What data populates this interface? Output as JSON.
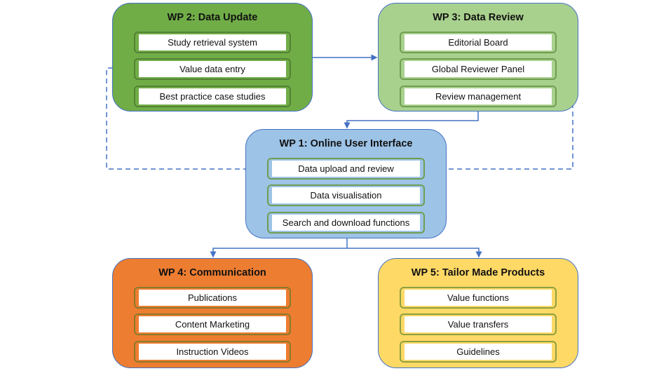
{
  "diagram": {
    "work_packages": [
      {
        "id": "wp2",
        "title": "WP 2: Data Update",
        "color": "#70ad47",
        "items": [
          "Study retrieval system",
          "Value data entry",
          "Best practice case studies"
        ]
      },
      {
        "id": "wp3",
        "title": "WP 3: Data Review",
        "color": "#a9d18e",
        "items": [
          "Editorial Board",
          "Global Reviewer Panel",
          "Review management"
        ]
      },
      {
        "id": "wp1",
        "title": "WP 1: Online User Interface",
        "color": "#9dc3e6",
        "items": [
          "Data upload and review",
          "Data visualisation",
          "Search and download functions"
        ]
      },
      {
        "id": "wp4",
        "title": "WP 4: Communication",
        "color": "#ed7d31",
        "items": [
          "Publications",
          "Content Marketing",
          "Instruction Videos"
        ]
      },
      {
        "id": "wp5",
        "title": "WP 5: Tailor Made Products",
        "color": "#ffd966",
        "items": [
          "Value functions",
          "Value transfers",
          "Guidelines"
        ]
      }
    ],
    "connections": [
      {
        "from": "WP 2: Data Update",
        "to": "WP 3: Data Review",
        "style": "solid"
      },
      {
        "from": "WP 3: Data Review",
        "to": "WP 1: Online User Interface",
        "style": "solid"
      },
      {
        "from": "WP 1: Online User Interface",
        "to": "WP 4: Communication",
        "style": "solid"
      },
      {
        "from": "WP 1: Online User Interface",
        "to": "WP 5: Tailor Made Products",
        "style": "solid"
      },
      {
        "from": "Data upload and review",
        "to": "Study retrieval system / Value data entry / Best practice case studies",
        "style": "dashed"
      },
      {
        "from": "Review management",
        "to": "Data upload and review",
        "style": "dashed"
      }
    ],
    "connector_color": "#4472c4"
  }
}
